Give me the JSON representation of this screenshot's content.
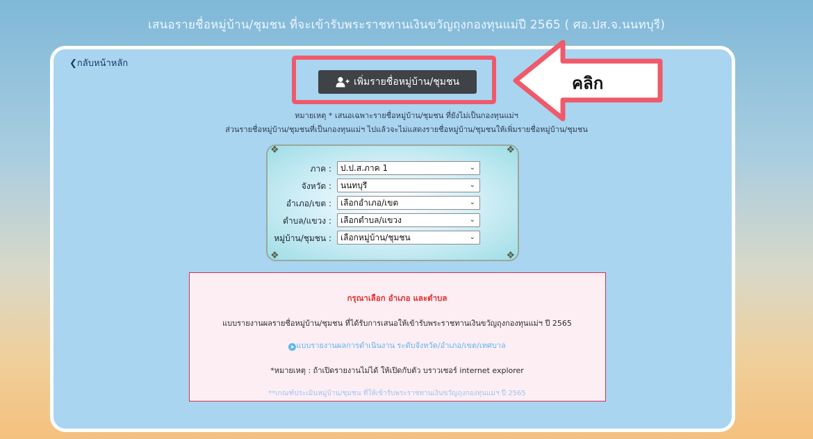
{
  "page": {
    "title": "เสนอรายชื่อหมู่บ้าน/ชุมชน ที่จะเข้ารับพระราชทานเงินขวัญถุงกองทุนแม่ปี 2565 ( ศอ.ปส.จ.นนทบุรี)"
  },
  "nav": {
    "back_label": "กลับหน้าหลัก"
  },
  "toolbar": {
    "add_label": "เพิ่มรายชื่อหมู่บ้าน/ชุมชน"
  },
  "annotation": {
    "click_label": "คลิก",
    "color": "#ef5a6b"
  },
  "notes": {
    "line1": "หมายเหตุ * เสนอเฉพาะรายชื่อหมู่บ้าน/ชุมชน ที่ยังไม่เป็นกองทุนแม่ฯ",
    "line2": "ส่วนรายชื่อหมู่บ้าน/ชุมชนที่เป็นกองทุนแม่ฯ ไปแล้วจะไม่แสดงรายชื่อหมู่บ้าน/ชุมชนให้เพิ่มรายชื่อหมู่บ้าน/ชุมชน"
  },
  "filters": [
    {
      "label": "ภาค :",
      "value": "ป.ป.ส.ภาค 1"
    },
    {
      "label": "จังหวัด :",
      "value": "นนทบุรี"
    },
    {
      "label": "อำเภอ/เขต :",
      "value": "เลือกอำเภอ/เขต"
    },
    {
      "label": "ตำบล/แขวง :",
      "value": "เลือกตำบล/แขวง"
    },
    {
      "label": "หมู่บ้าน/ชุมชน :",
      "value": "เลือกหมู่บ้าน/ชุมชน"
    }
  ],
  "report": {
    "warning": "กรุณาเลือก อำเภอ และตำบล",
    "summary": "แบบรายงานผลรายชื่อหมู่บ้าน/ชุมชน ที่ได้รับการเสนอให้เข้ารับพระราชทานเงินขวัญถุงกองทุนแม่ฯ ปี 2565",
    "link": "แบบรายงานผลการดำเนินงาน ระดับจังหวัด/อำเภอ/เขต/เทศบาล",
    "note": "*หมายเหตุ : ถ้าเปิดรายงานไม่ได้ ให้เปิดกับตัว บราวเซอร์ internet explorer",
    "footer_link": "**เกณฑ์ประเมินหมู่บ้าน/ชุมชน ที่ให้เข้ารับพระราชทานเงินขวัญถุงกองทุนแม่ฯ ปี 2565"
  }
}
